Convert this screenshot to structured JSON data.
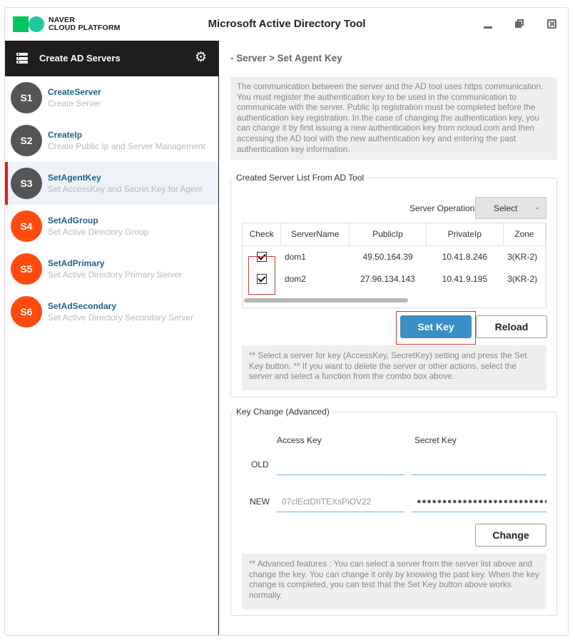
{
  "brand": {
    "logo_line1": "NAVER",
    "logo_line2": "CLOUD PLATFORM",
    "logo_colors": [
      "#03c75a",
      "#1ec8a0"
    ]
  },
  "window": {
    "title": "Microsoft Active Directory Tool",
    "controls": [
      "minimize-icon",
      "restore-icon",
      "close-icon"
    ]
  },
  "sidebar": {
    "header": {
      "label": "Create AD Servers",
      "icon": "server-icon",
      "settings_icon": "gear-icon"
    },
    "items": [
      {
        "badge": "S1",
        "label": "CreateServer",
        "sub": "Create Server",
        "color": "#555555",
        "active": false
      },
      {
        "badge": "S2",
        "label": "CreateIp",
        "sub": "Create Public Ip and Server Management",
        "color": "#555555",
        "active": false
      },
      {
        "badge": "S3",
        "label": "SetAgentKey",
        "sub": "Set AccessKey and Secret Key for Agent",
        "color": "#555555",
        "active": true
      },
      {
        "badge": "S4",
        "label": "SetAdGroup",
        "sub": "Set Active Directory Group",
        "color": "#ff4b0f",
        "active": false
      },
      {
        "badge": "S5",
        "label": "SetAdPrimary",
        "sub": "Set Active Directory Primary Server",
        "color": "#ff4b0f",
        "active": false
      },
      {
        "badge": "S6",
        "label": "SetAdSecondary",
        "sub": "Set Active Directory Secondary Server",
        "color": "#ff4b0f",
        "active": false
      }
    ],
    "active_accent": "#e8191f"
  },
  "main": {
    "breadcrumb": "- Server > Set Agent Key",
    "info_text": "The communication between the server and the AD tool uses https communication. You must register the authentication key to be used in the communication to communicate with the server. Public Ip registration must be completed before the authentication key registration. In the case of changing the authentication key, you can change it by first issuing a new authentication key from ncloud.com and then accessing the AD tool with the new authentication key and entering the past authentication key information.",
    "server_list": {
      "legend": "Created Server List From AD Tool",
      "operation_label": "Server Operation",
      "operation_value": "Select",
      "columns": [
        "Check",
        "ServerName",
        "PublicIp",
        "PrivateIp",
        "Zone"
      ],
      "rows": [
        {
          "checked": true,
          "name": "dom1",
          "public_ip": "49.50.164.39",
          "private_ip": "10.41.8.246",
          "zone": "3(KR-2)"
        },
        {
          "checked": true,
          "name": "dom2",
          "public_ip": "27.96.134.143",
          "private_ip": "10.41.9.195",
          "zone": "3(KR-2)"
        }
      ],
      "set_key_label": "Set Key",
      "reload_label": "Reload",
      "note": "** Select a server for key (AccessKey, SecretKey) setting and press the Set Key button. ** If you want to delete the server or other actions, select the server and select a function from the combo box above."
    },
    "key_change": {
      "legend": "Key Change (Advanced)",
      "access_key_header": "Access Key",
      "secret_key_header": "Secret Key",
      "old_label": "OLD",
      "new_label": "NEW",
      "old_access_key": "",
      "old_secret_key": "",
      "new_access_key": "07clEctDIITEXsPiOV22",
      "new_secret_key_masked": "●●●●●●●●●●●●●●●●●●●●●●●●●●●",
      "change_label": "Change",
      "note": "** Advanced features : You can select a server from the server list above and change the key. You can change it only by knowing the past key. When the key change is completed, you can test that the Set Key button above works normally."
    },
    "primary_color": "#3a8fc5"
  }
}
